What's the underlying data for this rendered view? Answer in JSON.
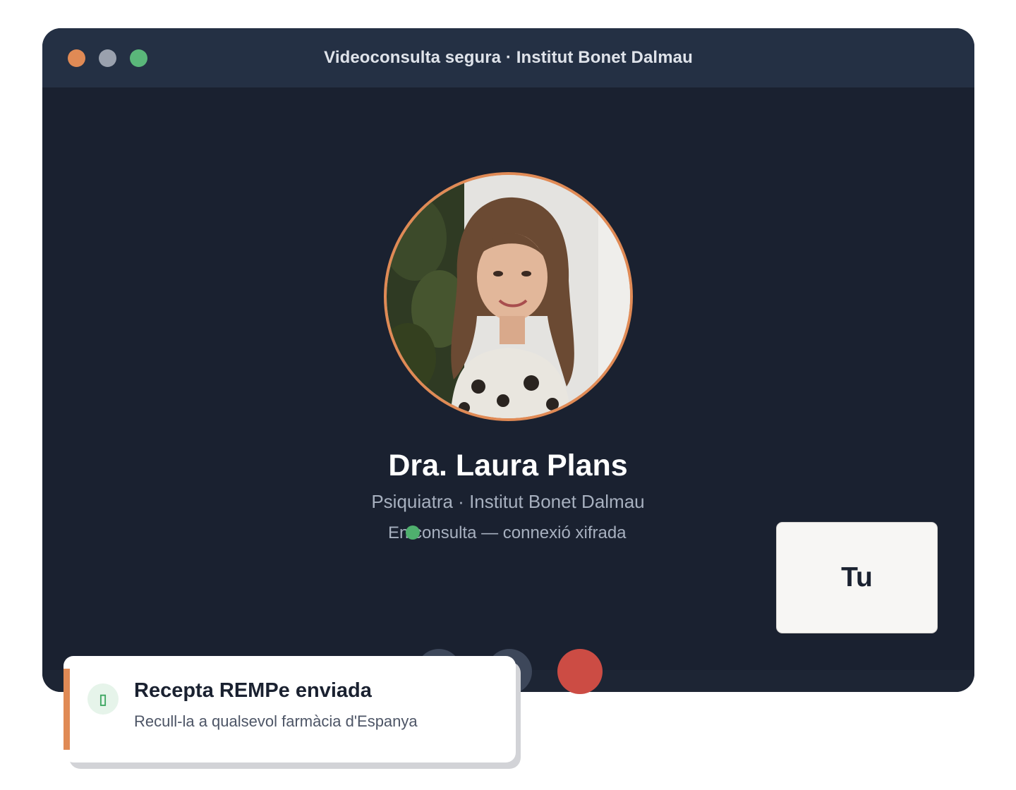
{
  "window": {
    "title": "Videoconsulta segura · Institut Bonet Dalmau",
    "controls": [
      "close",
      "minimize",
      "maximize"
    ]
  },
  "call": {
    "doctor_name": "Dra. Laura Plans",
    "doctor_role": "Psiquiatra · Institut Bonet Dalmau",
    "status": "En consulta — connexió xifrada",
    "self_label": "Tu",
    "buttons": [
      "mic-button",
      "camera-button",
      "hang-up-button"
    ]
  },
  "toast": {
    "icon": "mobile-icon",
    "icon_glyph": "▯",
    "title": "Recepta REMPe enviada",
    "subtitle": "Recull-la a qualsevol farmàcia d'Espanya"
  },
  "colors": {
    "accent": "#e08a55",
    "background": "#1a2130",
    "titlebar": "#243044",
    "status_green": "#4fb06e",
    "hang_up_red": "#cc4c44"
  }
}
